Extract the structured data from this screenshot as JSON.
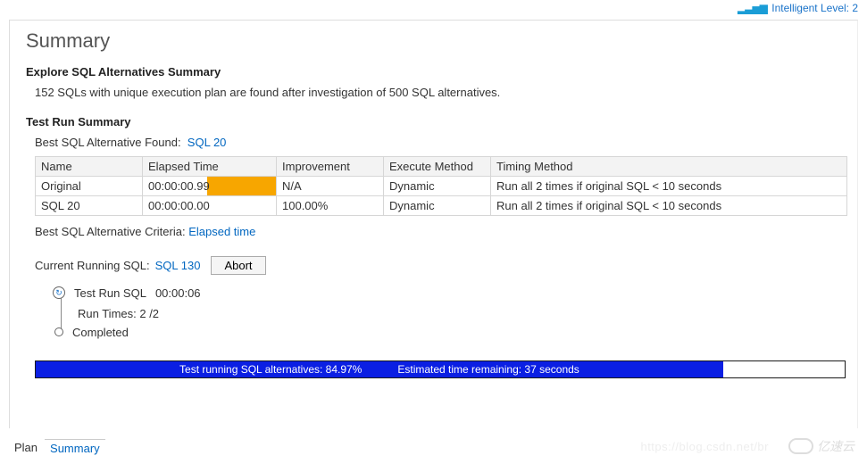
{
  "header": {
    "intelligent_level_label": "Intelligent Level: 2"
  },
  "page": {
    "title": "Summary"
  },
  "explore": {
    "title": "Explore SQL Alternatives Summary",
    "text": "152 SQLs with unique execution plan are found after investigation of 500 SQL alternatives."
  },
  "testrun": {
    "title": "Test Run Summary",
    "best_label": "Best SQL Alternative Found:",
    "best_value": "SQL 20",
    "columns": {
      "name": "Name",
      "elapsed": "Elapsed Time",
      "improvement": "Improvement",
      "execute": "Execute Method",
      "timing": "Timing Method"
    },
    "rows": [
      {
        "name": "Original",
        "elapsed": "00:00:00.99",
        "bar_pct": 52,
        "improvement": "N/A",
        "execute": "Dynamic",
        "timing": "Run all 2 times if original SQL < 10 seconds"
      },
      {
        "name": "SQL 20",
        "elapsed": "00:00:00.00",
        "bar_pct": 0,
        "improvement": "100.00%",
        "execute": "Dynamic",
        "timing": "Run all 2 times if original SQL < 10 seconds"
      }
    ],
    "criteria_label": "Best SQL Alternative Criteria:",
    "criteria_value": "Elapsed time"
  },
  "running": {
    "label": "Current Running SQL:",
    "sql": "SQL 130",
    "abort": "Abort",
    "tree": {
      "run_sql_label": "Test Run SQL",
      "run_sql_time": "00:00:06",
      "run_times": "Run Times: 2 /2",
      "completed": "Completed"
    }
  },
  "progress": {
    "text_left": "Test running SQL alternatives: 84.97%",
    "text_right": "Estimated time remaining: 37 seconds",
    "percent": 84.97
  },
  "tabs": {
    "plan": "Plan",
    "summary": "Summary"
  },
  "watermark": {
    "url": "https://blog.csdn.net/br",
    "brand": "亿速云"
  }
}
